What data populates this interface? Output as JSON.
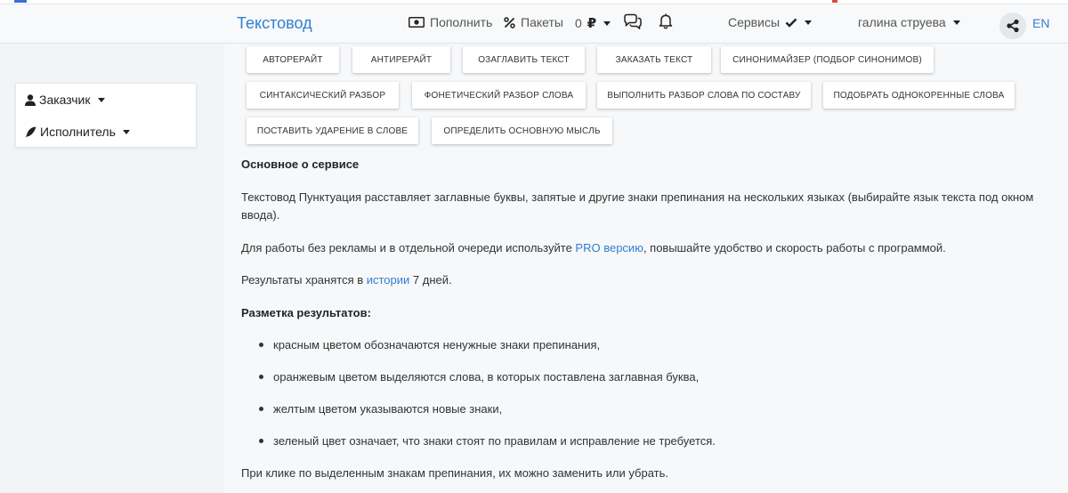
{
  "navbar": {
    "brand": "Текстовод",
    "topup_label": "Пополнить",
    "packages_label": "Пакеты",
    "balance_amount": "0",
    "balance_currency": "₽",
    "services_label": "Сервисы",
    "user_name": "галина струева",
    "lang": "EN"
  },
  "sidebar": {
    "customer_label": "Заказчик",
    "executor_label": "Исполнитель"
  },
  "buttons": [
    "Авторерайт",
    "Антирерайт",
    "Озаглавить текст",
    "Заказать текст",
    "Синонимайзер (подбор синонимов)",
    "Синтаксический разбор",
    "Фонетический разбор слова",
    "Выполнить разбор слова по составу",
    "Подобрать однокоренные слова",
    "Поставить ударение в слове",
    "Определить основную мысль"
  ],
  "content": {
    "about_heading": "Основное о сервисе",
    "p1": "Текстовод Пунктуация расставляет заглавные буквы, запятые и другие знаки препинания на нескольких языках (выбирайте язык текста под окном ввода).",
    "p2_before": "Для работы без рекламы и в отдельной очереди используйте ",
    "p2_link": "PRO версию",
    "p2_after": ", повышайте удобство и скорость работы с программой.",
    "p3_before": "Результаты хранятся в ",
    "p3_link": "истории",
    "p3_after": " 7 дней.",
    "markup_heading": "Разметка результатов:",
    "bullets": [
      "красным цветом обозначаются ненужные знаки препинания,",
      "оранжевым цветом выделяются слова, в которых поставлена заглавная буква,",
      "желтым цветом указываются новые знаки,",
      "зеленый цвет означает, что знаки стоят по правилам и исправление не требуется."
    ],
    "p4": "При клике по выделенным знакам препинания, их можно заменить или убрать."
  },
  "icons": {
    "topup": "cash-icon",
    "packages": "percent-icon",
    "chat": "chat-bubbles-icon",
    "bell": "bell-icon",
    "check": "check-icon",
    "share": "share-icon",
    "user": "user-icon",
    "feather": "feather-icon"
  },
  "colors": {
    "brand": "#2f7fd4",
    "navbar_bg": "#f8f9fa",
    "page_bg": "#f2f4f7"
  }
}
